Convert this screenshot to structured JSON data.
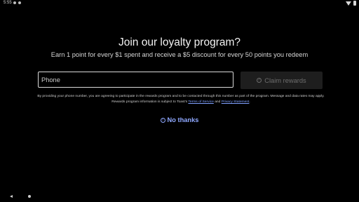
{
  "status_bar": {
    "time": "5:55",
    "icons": [
      "notification-icon",
      "notification-icon",
      "wifi-icon",
      "battery-icon"
    ]
  },
  "modal": {
    "title": "Join our loyalty program?",
    "subtitle": "Earn 1 point for every $1 spent and receive a $5 discount for every 50 points you redeem",
    "phone_placeholder": "Phone",
    "phone_value": "",
    "claim_button_label": "Claim rewards",
    "disclaimer_text_1": "By providing your phone number, you are agreeing to participate in the rewards program and to be contacted through this number as part of the program. Message and data rates may apply. Rewards program information is subject to Toast's ",
    "terms_link": "Terms of Service",
    "and_text": " and ",
    "privacy_link": "Privacy Statement",
    "disclaimer_end": ".",
    "no_thanks_label": "No thanks"
  },
  "colors": {
    "background": "#000000",
    "link": "#8fa8ff",
    "disabled_button_bg": "#1e1e1e",
    "disabled_text": "#6d6d6d"
  },
  "nav_bar": {
    "icons": [
      "back-icon",
      "home-icon"
    ]
  }
}
